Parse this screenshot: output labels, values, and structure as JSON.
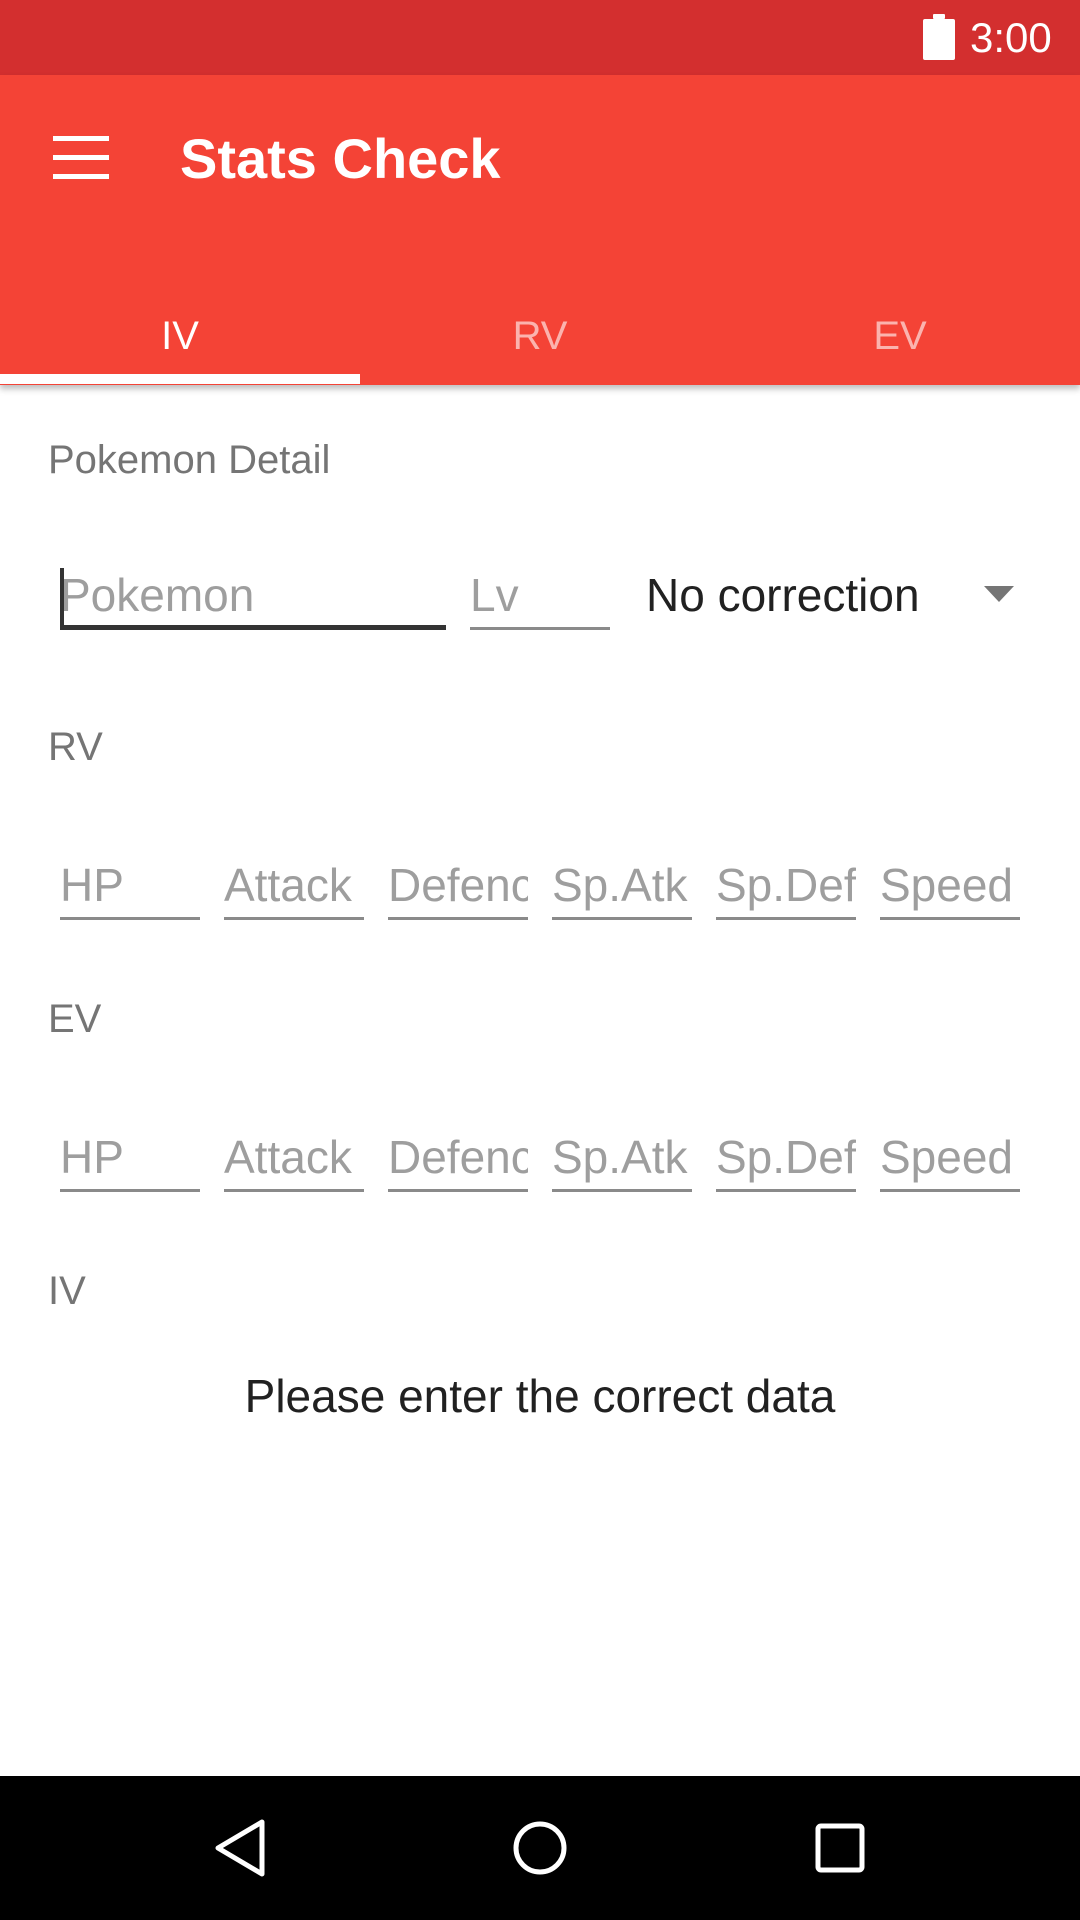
{
  "status_bar": {
    "time": "3:00",
    "battery_icon": "battery-full-icon"
  },
  "toolbar": {
    "menu_icon": "hamburger-menu-icon",
    "title": "Stats Check",
    "tabs": [
      {
        "label": "IV",
        "active": true
      },
      {
        "label": "RV",
        "active": false
      },
      {
        "label": "EV",
        "active": false
      }
    ]
  },
  "pokemon_detail": {
    "label": "Pokemon Detail",
    "pokemon_placeholder": "Pokemon",
    "pokemon_value": "",
    "level_placeholder": "Lv",
    "level_value": "",
    "correction_selected": "No correction"
  },
  "rv": {
    "label": "RV",
    "fields": [
      "HP",
      "Attack",
      "Defence",
      "Sp.Atk",
      "Sp.Def",
      "Speed"
    ]
  },
  "ev": {
    "label": "EV",
    "fields": [
      "HP",
      "Attack",
      "Defence",
      "Sp.Atk",
      "Sp.Def",
      "Speed"
    ]
  },
  "iv": {
    "label": "IV",
    "message": "Please enter the correct data"
  },
  "nav_bar": {
    "back_icon": "back-triangle-icon",
    "home_icon": "home-circle-icon",
    "recent_icon": "recent-apps-square-icon"
  },
  "colors": {
    "status_bar": "#d32f2f",
    "toolbar": "#f44336",
    "tab_indicator": "#ffffff"
  }
}
